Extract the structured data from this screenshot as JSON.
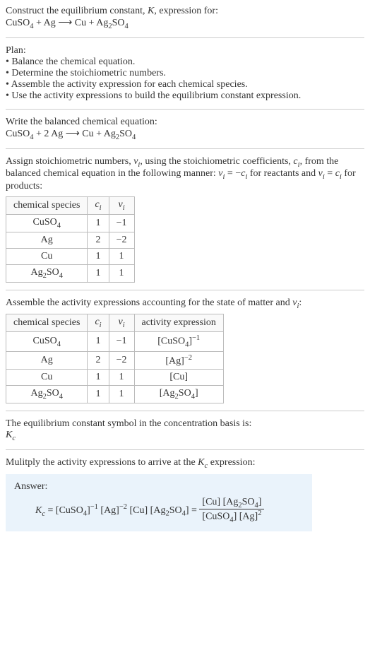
{
  "question": {
    "line1": "Construct the equilibrium constant, K, expression for:",
    "line2": "CuSO₄ + Ag ⟶ Cu + Ag₂SO₄"
  },
  "plan": {
    "title": "Plan:",
    "items": [
      "• Balance the chemical equation.",
      "• Determine the stoichiometric numbers.",
      "• Assemble the activity expression for each chemical species.",
      "• Use the activity expressions to build the equilibrium constant expression."
    ]
  },
  "balanced": {
    "title": "Write the balanced chemical equation:",
    "equation": "CuSO₄ + 2 Ag ⟶ Cu + Ag₂SO₄"
  },
  "assign": {
    "text": "Assign stoichiometric numbers, νᵢ, using the stoichiometric coefficients, cᵢ, from the balanced chemical equation in the following manner: νᵢ = −cᵢ for reactants and νᵢ = cᵢ for products:",
    "headers": [
      "chemical species",
      "cᵢ",
      "νᵢ"
    ],
    "rows": [
      {
        "species": "CuSO₄",
        "c": "1",
        "v": "−1"
      },
      {
        "species": "Ag",
        "c": "2",
        "v": "−2"
      },
      {
        "species": "Cu",
        "c": "1",
        "v": "1"
      },
      {
        "species": "Ag₂SO₄",
        "c": "1",
        "v": "1"
      }
    ]
  },
  "assemble": {
    "text": "Assemble the activity expressions accounting for the state of matter and νᵢ:",
    "headers": [
      "chemical species",
      "cᵢ",
      "νᵢ",
      "activity expression"
    ],
    "rows": [
      {
        "species": "CuSO₄",
        "c": "1",
        "v": "−1",
        "activity": "[CuSO₄]⁻¹"
      },
      {
        "species": "Ag",
        "c": "2",
        "v": "−2",
        "activity": "[Ag]⁻²"
      },
      {
        "species": "Cu",
        "c": "1",
        "v": "1",
        "activity": "[Cu]"
      },
      {
        "species": "Ag₂SO₄",
        "c": "1",
        "v": "1",
        "activity": "[Ag₂SO₄]"
      }
    ]
  },
  "symbol": {
    "line1": "The equilibrium constant symbol in the concentration basis is:",
    "line2": "K_c"
  },
  "multiply": {
    "text": "Mulitply the activity expressions to arrive at the K_c expression:"
  },
  "answer": {
    "label": "Answer:",
    "lhs": "K_c = [CuSO₄]⁻¹ [Ag]⁻² [Cu] [Ag₂SO₄] = ",
    "num": "[Cu] [Ag₂SO₄]",
    "den": "[CuSO₄] [Ag]²"
  },
  "chart_data": {
    "type": "table",
    "tables": [
      {
        "title": "Stoichiometric numbers",
        "columns": [
          "chemical species",
          "c_i",
          "ν_i"
        ],
        "rows": [
          [
            "CuSO4",
            1,
            -1
          ],
          [
            "Ag",
            2,
            -2
          ],
          [
            "Cu",
            1,
            1
          ],
          [
            "Ag2SO4",
            1,
            1
          ]
        ]
      },
      {
        "title": "Activity expressions",
        "columns": [
          "chemical species",
          "c_i",
          "ν_i",
          "activity expression"
        ],
        "rows": [
          [
            "CuSO4",
            1,
            -1,
            "[CuSO4]^-1"
          ],
          [
            "Ag",
            2,
            -2,
            "[Ag]^-2"
          ],
          [
            "Cu",
            1,
            1,
            "[Cu]"
          ],
          [
            "Ag2SO4",
            1,
            1,
            "[Ag2SO4]"
          ]
        ]
      }
    ]
  }
}
